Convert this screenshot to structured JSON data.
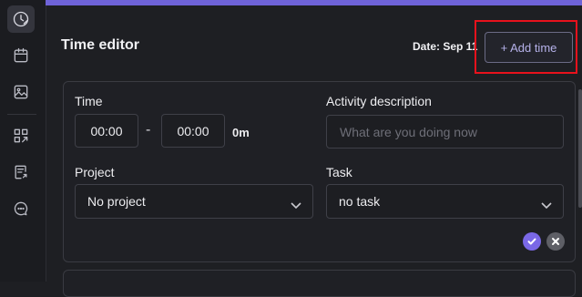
{
  "sidebar": {
    "items": [
      {
        "icon": "clock-edit-icon",
        "active": true
      },
      {
        "icon": "calendar-icon",
        "active": false
      },
      {
        "icon": "image-icon",
        "active": false
      },
      {
        "icon": "apps-icon",
        "active": false
      },
      {
        "icon": "report-icon",
        "active": false
      },
      {
        "icon": "chat-icon",
        "active": false
      }
    ]
  },
  "header": {
    "title": "Time editor",
    "date": "Date: Sep 11",
    "add_time_label": "+ Add time"
  },
  "form": {
    "time_label": "Time",
    "start_time": "00:00",
    "end_time": "00:00",
    "duration": "0m",
    "activity_label": "Activity description",
    "activity_placeholder": "What are you doing now",
    "project_label": "Project",
    "project_value": "No project",
    "task_label": "Task",
    "task_value": "no task"
  },
  "colors": {
    "accent": "#6f63d8",
    "highlight": "#e8121c",
    "confirm": "#7a68e6"
  }
}
